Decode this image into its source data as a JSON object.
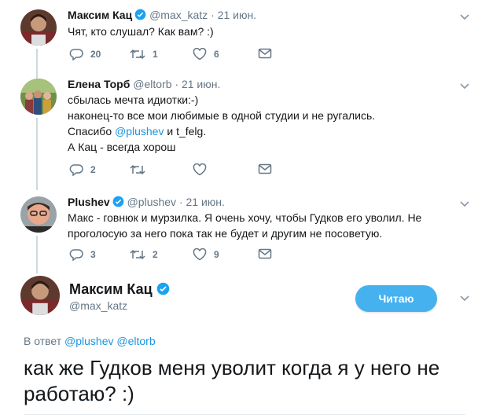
{
  "tweets": [
    {
      "name": "Максим Кац",
      "handle": "@max_katz",
      "dot": "·",
      "date": "21 июн.",
      "lines": [
        "Чят, кто слушал? Как вам? :)"
      ],
      "replies": "20",
      "retweets": "1",
      "likes": "6"
    },
    {
      "name": "Елена Торб",
      "handle": "@eltorb",
      "dot": "·",
      "date": "21 июн.",
      "lines": [
        "сбылась мечта идиотки:-)",
        "наконец-то все мои любимые в одной студии и не ругались.",
        "Спасибо ",
        "А Кац - всегда хорош"
      ],
      "mention": "@plushev",
      "mention_suffix": " и t_felg.",
      "replies": "2",
      "retweets": "",
      "likes": ""
    },
    {
      "name": "Plushev",
      "handle": "@plushev",
      "dot": "·",
      "date": "21 июн.",
      "lines": [
        "Макс - говнюк и мурзилка. Я очень хочу, чтобы Гудков его уволил. Не",
        "проголосую  за него пока так не будет и другим не посоветую."
      ],
      "replies": "3",
      "retweets": "2",
      "likes": "9"
    }
  ],
  "main_tweet": {
    "name": "Максим Кац",
    "handle": "@max_katz",
    "follow_label": "Читаю",
    "reply_prefix": "В ответ",
    "reply_mentions": "@plushev @eltorb",
    "text": "как же Гудков меня уволит когда я у него не работаю? :)"
  },
  "colors": {
    "link": "#1b95e0",
    "verified": "#1da1f2",
    "follow_button": "#46b1ef",
    "thread_line": "#cfd9de",
    "muted": "#657786"
  }
}
